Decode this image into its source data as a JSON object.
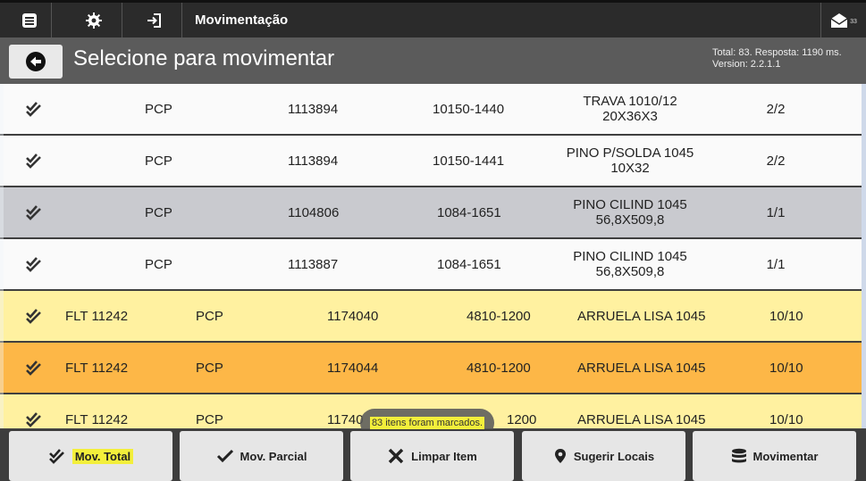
{
  "topbar": {
    "title": "Movimentação",
    "menu_icon": "menu-icon",
    "settings_icon": "gear-icon",
    "login_icon": "sign-in-icon",
    "mail_icon": "envelope-icon",
    "mail_count": "33"
  },
  "header": {
    "back_icon": "arrow-left-icon",
    "title": "Selecione para movimentar",
    "stats": "Total: 83. Resposta: 1190 ms.",
    "version": "Version: 2.2.1.1"
  },
  "rows": [
    {
      "color": "w",
      "col1": "",
      "col2": "PCP",
      "col3": "1113894",
      "col4": "10150-1440",
      "desc1": "TRAVA 1010/12",
      "desc2": "20X36X3",
      "qty": "2/2"
    },
    {
      "color": "w",
      "col1": "",
      "col2": "PCP",
      "col3": "1113894",
      "col4": "10150-1441",
      "desc1": "PINO P/SOLDA 1045",
      "desc2": "10X32",
      "qty": "2/2"
    },
    {
      "color": "g",
      "col1": "",
      "col2": "PCP",
      "col3": "1104806",
      "col4": "1084-1651",
      "desc1": "PINO CILIND 1045",
      "desc2": "56,8X509,8",
      "qty": "1/1"
    },
    {
      "color": "w",
      "col1": "",
      "col2": "PCP",
      "col3": "1113887",
      "col4": "1084-1651",
      "desc1": "PINO CILIND 1045",
      "desc2": "56,8X509,8",
      "qty": "1/1"
    },
    {
      "color": "y",
      "col1": "FLT 11242",
      "col2": "PCP",
      "col3": "1174040",
      "col4": "4810-1200",
      "desc1": "ARRUELA LISA 1045",
      "desc2": "",
      "qty": "10/10"
    },
    {
      "color": "o",
      "col1": "FLT 11242",
      "col2": "PCP",
      "col3": "1174044",
      "col4": "4810-1200",
      "desc1": "ARRUELA LISA 1045",
      "desc2": "",
      "qty": "10/10"
    },
    {
      "color": "y",
      "col1": "FLT 11242",
      "col2": "PCP",
      "col3": "11740",
      "col4": "1200",
      "desc1": "ARRUELA LISA 1045",
      "desc2": "",
      "qty": "10/10"
    }
  ],
  "toast": "83 itens foram marcados.",
  "bottom": {
    "mov_total": "Mov. Total",
    "mov_parcial": "Mov. Parcial",
    "limpar": "Limpar Item",
    "sugerir": "Sugerir Locais",
    "movimentar": "Movimentar"
  },
  "colors": {
    "white_row": "#fafafa",
    "gray_row": "#c9cacf",
    "yellow_row": "#fff1a0",
    "orange_row": "#fdb747",
    "highlight": "#f3ef3b"
  }
}
